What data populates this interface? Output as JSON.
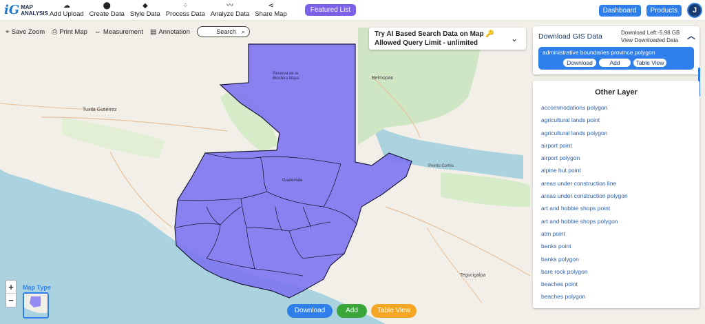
{
  "logo": {
    "mark": "iG",
    "line1": "MAP",
    "line2": "ANALYSIS"
  },
  "nav": [
    {
      "label": "Add Upload",
      "icon": "☁"
    },
    {
      "label": "Create Data",
      "icon": "📍"
    },
    {
      "label": "Style Data",
      "icon": "◆"
    },
    {
      "label": "Process Data",
      "icon": "⚙"
    },
    {
      "label": "Analyze Data",
      "icon": "〰"
    },
    {
      "label": "Share Map",
      "icon": "⋖"
    }
  ],
  "featured_label": "Featured List",
  "dashboard_label": "Dashboard",
  "products_label": "Products",
  "avatar_initial": "J",
  "map_tools": {
    "save_zoom": "Save Zoom",
    "print_map": "Print Map",
    "measurement": "Measurement",
    "annotation": "Annotation",
    "search": "Search"
  },
  "ai_search": {
    "line1": "Try AI Based Search Data on Map 🔑",
    "line2": "Allowed Query Limit - unlimited"
  },
  "download_panel": {
    "title": "Download GIS Data",
    "download_left": "Download Left:-5.98 GB",
    "view_downloaded": "View Downloaded Data",
    "selected_layer": "administrative boundaries province polygon",
    "download_btn": "Download",
    "add_btn": "Add",
    "table_view_btn": "Table View"
  },
  "other_layer": {
    "title": "Other Layer",
    "items": [
      "accommodations polygon",
      "agricultural lands point",
      "agricultural lands polygon",
      "airport point",
      "airport polygon",
      "alpine hut point",
      "areas under construction line",
      "areas under construction polygon",
      "art and hobbie shops point",
      "art and hobbie shops polygon",
      "atm point",
      "banks point",
      "banks polygon",
      "bare rock polygon",
      "beaches point",
      "beaches polygon"
    ]
  },
  "map_type_label": "Map Type",
  "map_labels": {
    "tuxtla": "Tuxtla Gutiérrez",
    "belmopan": "Belmopan",
    "guatemala": "Guatemala",
    "tegucigalpa": "Tegucigalpa",
    "reserva": "Reserva de la Biosfera Maya",
    "puerto_cortes": "Puerto Cortés"
  },
  "bottom": {
    "download": "Download",
    "add": "Add",
    "table_view": "Table View"
  },
  "colors": {
    "primary": "#2f7fea",
    "featured": "#7b61e8",
    "add_green": "#3aa63a",
    "table_orange": "#f5a623",
    "polygon_fill": "#7b72f0",
    "water": "#aad3df"
  }
}
